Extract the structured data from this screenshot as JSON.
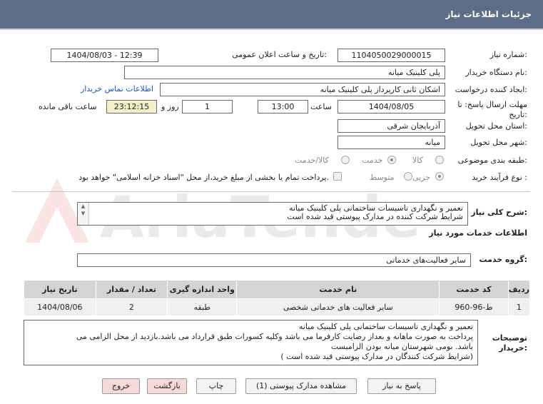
{
  "header": {
    "title": "جزئیات اطلاعات نیاز"
  },
  "form": {
    "need_number_label": "شماره نیاز:",
    "need_number": "1104050029000015",
    "announce_label": "تاریخ و ساعت اعلان عمومی:",
    "announce_value": "1404/08/03 - 12:39",
    "buyer_org_label": "نام دستگاه خریدار:",
    "buyer_org": "پلی کلینیک میانه",
    "creator_label": "ایجاد کننده درخواست:",
    "creator": "اشکان ثانی کارپرداز پلی کلینیک میانه",
    "contact_link": "اطلاعات تماس خریدار",
    "deadline_label": "مهلت ارسال پاسخ: تا تاریخ:",
    "deadline_date": "1404/08/05",
    "time_label": "ساعت",
    "deadline_time": "13:00",
    "days_value": "1",
    "days_label": "روز و",
    "remaining_time": "23:12:15",
    "remaining_label": "ساعت باقی مانده",
    "province_label": "استان محل تحویل:",
    "province": "آذربایجان شرقی",
    "city_label": "شهر محل تحویل:",
    "city": "میانه",
    "category_label": "طبقه بندی موضوعی:",
    "category_options": [
      "کالا",
      "خدمت",
      "کالا/خدمت"
    ],
    "category_selected": "خدمت",
    "process_label": "نوع فرآیند خرید :",
    "process_options": [
      "جزیی",
      "متوسط"
    ],
    "payment_note": "پرداخت تمام یا بخشی از مبلغ خرید،از محل \"اسناد خزانه اسلامی\" خواهد بود."
  },
  "description": {
    "label": "شرح کلی نیاز:",
    "text_line1": "تعمیر و نگهداری تاسیسات ساختمانی پلی کلینیک میانه",
    "text_line2": "شرایط شرکت کننده در مدارک پیوستی قید شده است"
  },
  "services": {
    "section_title": "اطلاعات خدمات مورد نیاز",
    "group_label": "گروه خدمت:",
    "group_value": "سایر فعالیت‌های خدماتی"
  },
  "table": {
    "headers": [
      "ردیف",
      "کد خدمت",
      "نام خدمت",
      "واحد اندازه گیری",
      "تعداد / مقدار",
      "تاریخ نیاز"
    ],
    "rows": [
      [
        "1",
        "ط-96-960",
        "سایر فعالیت های خدماتی شخصی",
        "طبقه",
        "2",
        "1404/08/06"
      ]
    ]
  },
  "buyer_notes": {
    "label": "توضیحات خریدار:",
    "line1": "تعمیر و نگهداری تاسیسات ساختمانی پلی کلینیک میانه",
    "line2": "پرداخت به صورت ماهانه و بعداز رضایت کارفرما می باشد وکلیه کسورات طبق قرارداد می باشد.بازدید از محل الزامی می",
    "line3": "باشد. بومی شهرستان میانه بودن الزامیست",
    "line4": "(شرایط شرکت کنندگان در مدارک پیوستی قید شده است )"
  },
  "buttons": {
    "reply": "پاسخ به نیاز",
    "attachments": "مشاهده مدارک پیوستی (1)",
    "print": "چاپ",
    "back": "بازگشت",
    "exit": "خروج"
  },
  "watermark": {
    "text": "AriaTender.neT"
  }
}
